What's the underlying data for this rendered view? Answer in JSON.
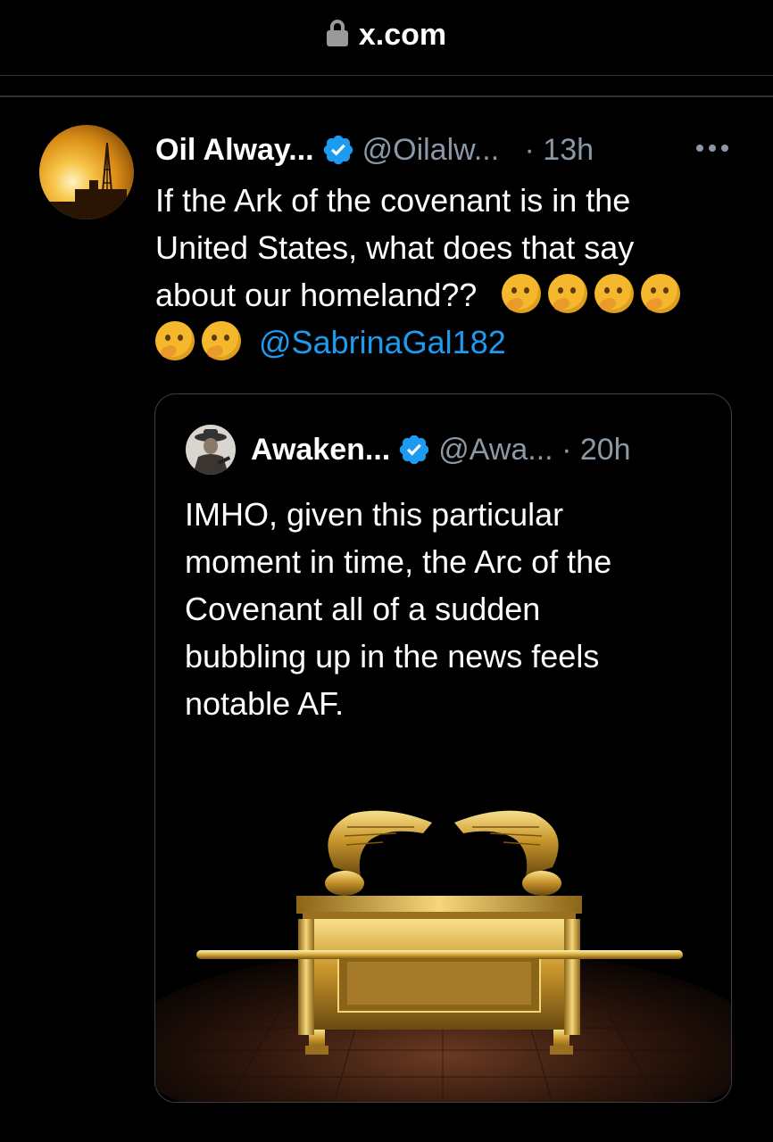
{
  "browser": {
    "url": "x.com"
  },
  "tweet": {
    "name": "Oil Alway...",
    "handle": "@Oilalw...",
    "separator": "·",
    "time": "13h",
    "text_line1": "If the Ark of the covenant is in the",
    "text_line2": "United States, what does that say",
    "text_line3": "about our homeland??",
    "mention": "@SabrinaGal182",
    "emoji_count": 6
  },
  "quote": {
    "name": "Awaken...",
    "handle": "@Awa...",
    "separator": "·",
    "time": "20h",
    "text_line1": "IMHO, given this particular",
    "text_line2": "moment in time, the Arc of the",
    "text_line3": "Covenant all of a sudden",
    "text_line4": "bubbling up in the news feels",
    "text_line5": "notable AF."
  },
  "colors": {
    "background": "#000000",
    "text": "#ffffff",
    "secondary": "#8b98a5",
    "accent": "#1d9bf0",
    "border": "#2f3336",
    "verified": "#1d9bf0"
  },
  "icons": [
    "lock-icon",
    "verified-icon",
    "more-icon",
    "thinking-face-emoji"
  ]
}
